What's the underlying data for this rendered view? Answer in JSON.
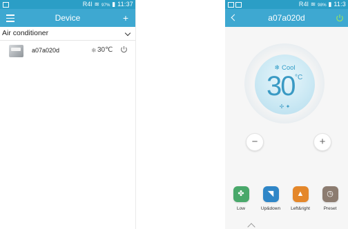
{
  "phone1": {
    "status": {
      "time": "11:37",
      "battery": "97%",
      "signal": "R4l"
    },
    "appbar": {
      "title": "Device"
    },
    "section": {
      "label": "Air conditioner"
    },
    "device": {
      "name": "a07a020d",
      "mode_icon": "snowflake-icon",
      "temperature": "30℃"
    },
    "colors": {
      "accent": "#3ea8d1",
      "status": "#2b9ec6"
    }
  },
  "phone2": {
    "status": {
      "time": "11:3",
      "battery": "98%",
      "signal": "R4l"
    },
    "appbar": {
      "title": "a07a020d"
    },
    "dial": {
      "mode": "Cool",
      "temperature": "30",
      "unit": "°C"
    },
    "controls": {
      "minus": "−",
      "plus": "+"
    },
    "modes": [
      {
        "label": "Low",
        "icon": "fan-icon",
        "color": "#49a86a"
      },
      {
        "label": "Up&down",
        "icon": "updown-icon",
        "color": "#2f86c7"
      },
      {
        "label": "Left&right",
        "icon": "leftright-icon",
        "color": "#e4872a"
      },
      {
        "label": "Preset",
        "icon": "clock-icon",
        "color": "#8c7c70"
      }
    ]
  }
}
